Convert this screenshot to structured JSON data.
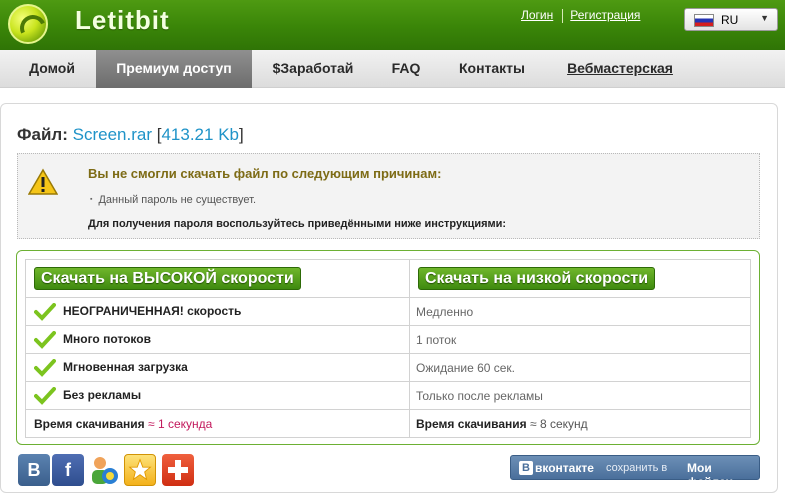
{
  "header": {
    "logo_text": "Letitbit",
    "login": "Логин",
    "register": "Регистрация",
    "language": "RU"
  },
  "nav": {
    "items": [
      {
        "label": "Домой"
      },
      {
        "label": "Премиум доступ",
        "active": true
      },
      {
        "label": "$Заработай"
      },
      {
        "label": "FAQ"
      },
      {
        "label": "Контакты"
      },
      {
        "label": "Вебмастерская"
      }
    ]
  },
  "file": {
    "prefix": "Файл:",
    "name": "Screen.rar",
    "size": "413.21 Kb",
    "bracket_open": "[",
    "bracket_close": "]"
  },
  "warning": {
    "title": "Вы не смогли скачать файл по следующим причинам:",
    "reasons": [
      "Данный пароль не существует."
    ],
    "note": "Для получения пароля воспользуйтесь приведёнными ниже инструкциями:"
  },
  "compare": {
    "fast_button": "Скачать на ВЫСОКОЙ скорости",
    "slow_button": "Скачать на низкой скорости",
    "rows": [
      {
        "fast": "НЕОГРАНИЧЕННАЯ! скорость",
        "slow": "Медленно"
      },
      {
        "fast": "Много потоков",
        "slow": "1 поток"
      },
      {
        "fast": "Мгновенная загрузка",
        "slow": "Ожидание 60 сек."
      },
      {
        "fast": "Без рекламы",
        "slow": "Только после рекламы"
      }
    ],
    "time_label": "Время скачивания",
    "approx": "≈",
    "fast_time": "1 секунда",
    "slow_time": "8 секунд"
  },
  "social": {
    "vk_letter": "B",
    "fb_letter": "f",
    "vk_button_brand": "вконтакте",
    "vk_button_save": "сохранить в",
    "vk_button_files": "Мои файлах"
  },
  "colors": {
    "brand_green": "#3a8508",
    "link_blue": "#1f93c8",
    "fast_time": "#c2185b"
  }
}
